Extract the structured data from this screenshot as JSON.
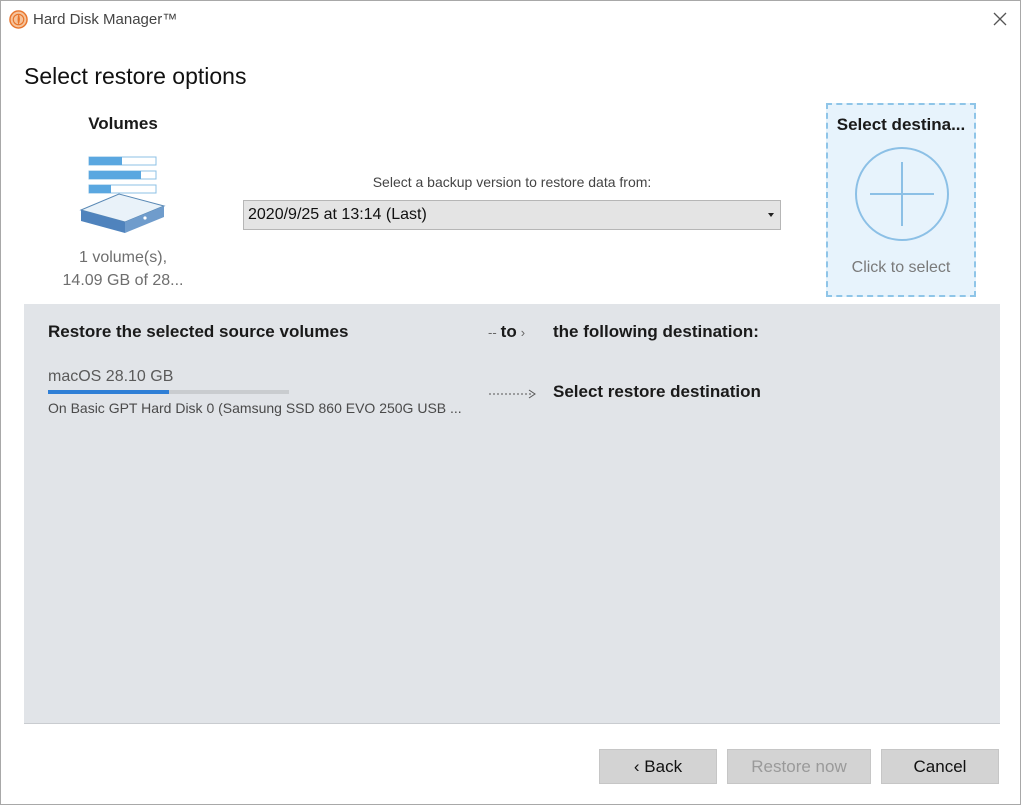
{
  "window": {
    "title": "Hard Disk Manager™"
  },
  "page": {
    "title": "Select restore options"
  },
  "source": {
    "heading": "Volumes",
    "summary_line1": "1 volume(s),",
    "summary_line2": "14.09 GB of 28..."
  },
  "backup": {
    "label": "Select a backup version to restore data from:",
    "selected_version": "2020/9/25 at 13:14 (Last)"
  },
  "destination_card": {
    "heading": "Select destina...",
    "click_label": "Click to select"
  },
  "panel": {
    "source_heading": "Restore the selected source volumes",
    "to_label": "to",
    "dest_heading": "the following destination:",
    "volume": {
      "name": "macOS 28.10 GB",
      "location": "On Basic GPT Hard Disk 0 (Samsung SSD 860 EVO 250G USB ...",
      "used_fraction": 0.5
    },
    "restore_destination": "Select restore destination"
  },
  "buttons": {
    "back": "‹ Back",
    "restore_now": "Restore now",
    "cancel": "Cancel"
  },
  "colors": {
    "accent": "#2f7fd6",
    "dest_card_border": "#8fc5e8",
    "dest_card_bg": "#e7f3fc",
    "panel_bg": "#e1e4e8",
    "app_icon": "#e8742a"
  },
  "icons": {
    "app": "app-logo-icon",
    "close": "close-icon",
    "volumes": "disk-stack-icon",
    "add": "plus-circle-icon",
    "caret": "chevron-down-icon",
    "arrow": "dashed-arrow-icon"
  }
}
